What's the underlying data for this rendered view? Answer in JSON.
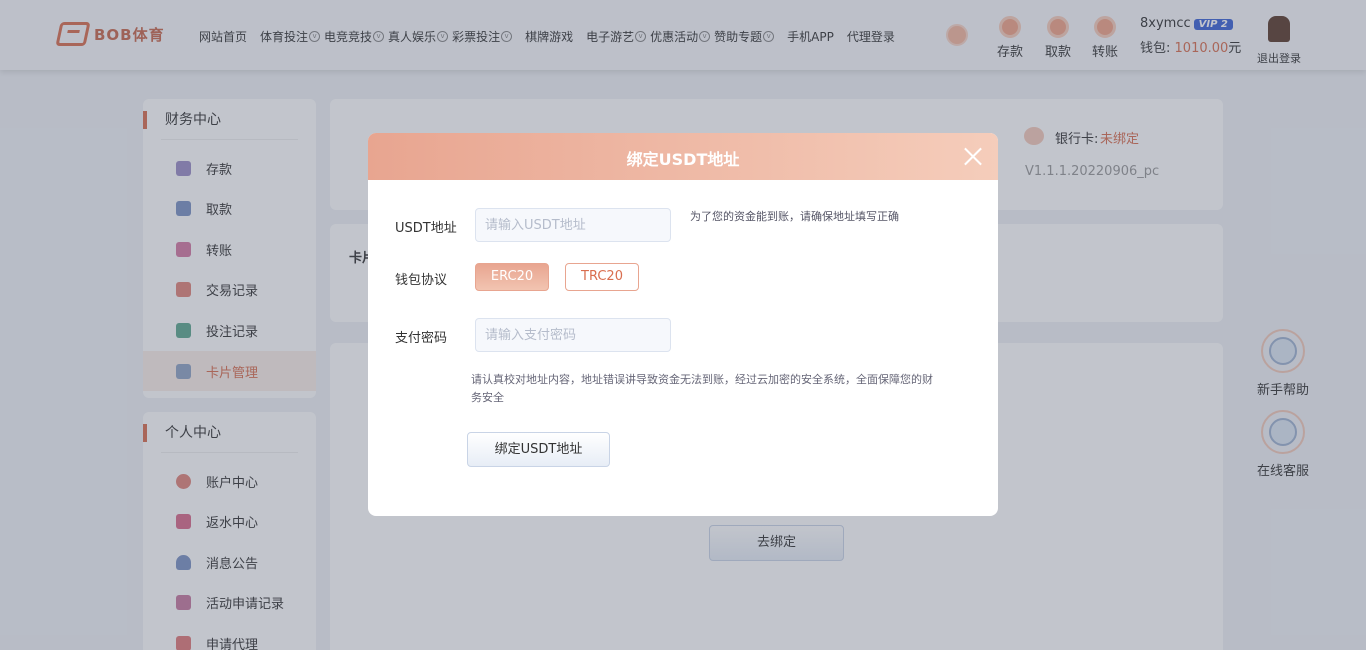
{
  "brand": {
    "name": "BOB体育"
  },
  "nav": [
    {
      "label": "网站首页",
      "chev": false
    },
    {
      "label": "体育投注",
      "chev": true
    },
    {
      "label": "电竞竞技",
      "chev": true
    },
    {
      "label": "真人娱乐",
      "chev": true
    },
    {
      "label": "彩票投注",
      "chev": true
    },
    {
      "label": "棋牌游戏",
      "chev": true
    },
    {
      "label": "电子游艺",
      "chev": true
    },
    {
      "label": "优惠活动",
      "chev": true
    },
    {
      "label": "赞助专题",
      "chev": true
    },
    {
      "label": "手机APP",
      "chev": false
    },
    {
      "label": "代理登录",
      "chev": false
    }
  ],
  "header_actions": {
    "deposit": "存款",
    "withdraw": "取款",
    "transfer": "转账"
  },
  "user": {
    "name": "8xymcc",
    "vip": "VIP 2",
    "wallet_label": "钱包:",
    "wallet_amount": "1010.00",
    "wallet_unit": "元",
    "logout": "退出登录"
  },
  "finance": {
    "title": "财务中心",
    "items": [
      "存款",
      "取款",
      "转账",
      "交易记录",
      "投注记录",
      "卡片管理"
    ],
    "active": "卡片管理"
  },
  "personal": {
    "title": "个人中心",
    "items": [
      "账户中心",
      "返水中心",
      "消息公告",
      "活动申请记录",
      "申请代理"
    ]
  },
  "bank": {
    "label": "银行卡:",
    "status": "未绑定",
    "version": "V1.1.1.20220906_pc"
  },
  "card_section": {
    "label": "卡片"
  },
  "main": {
    "bind_button": "去绑定"
  },
  "float": {
    "help": "新手帮助",
    "service": "在线客服"
  },
  "modal": {
    "title": "绑定USDT地址",
    "address_label": "USDT地址",
    "address_placeholder": "请输入USDT地址",
    "address_hint": "为了您的资金能到账，请确保地址填写正确",
    "protocol_label": "钱包协议",
    "protocols": [
      "ERC20",
      "TRC20"
    ],
    "selected_protocol": "ERC20",
    "password_label": "支付密码",
    "password_placeholder": "请输入支付密码",
    "notice": "请认真校对地址内容，地址错误讲导致资金无法到账，经过云加密的安全系统，全面保障您的财务安全",
    "submit": "绑定USDT地址"
  },
  "colors": {
    "accent": "#d96e4f",
    "vip": "#3b63d6"
  }
}
